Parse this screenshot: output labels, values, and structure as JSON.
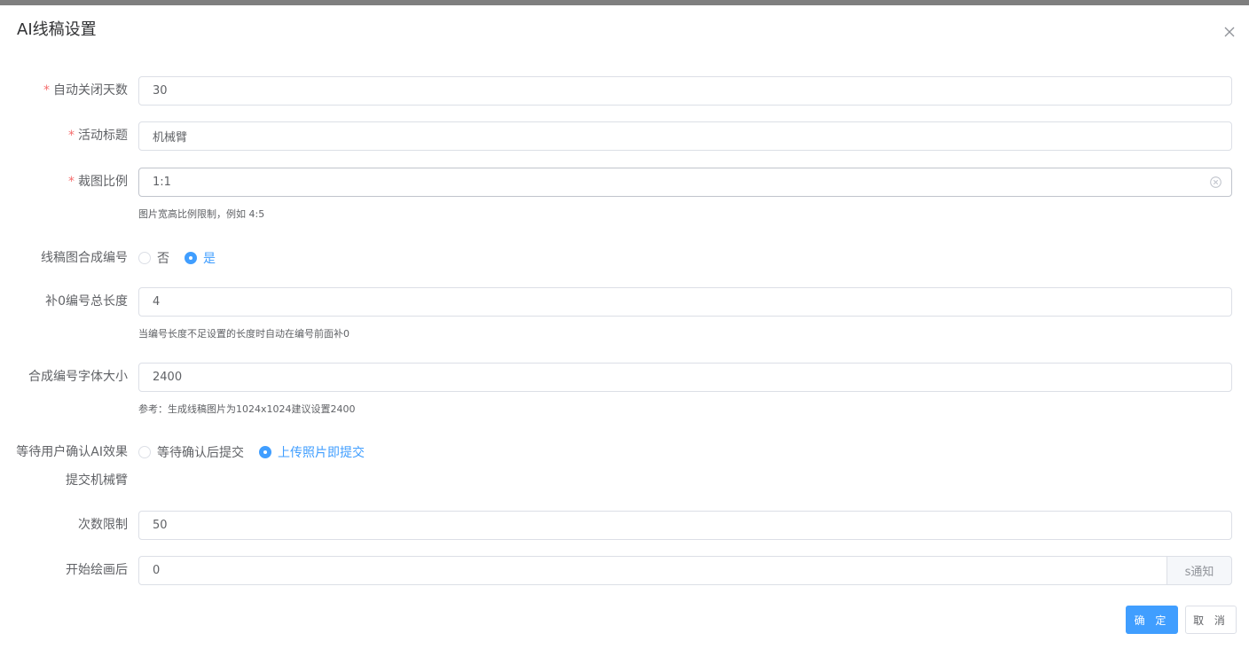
{
  "dialog": {
    "title": "AI线稿设置",
    "close_icon": "close-icon"
  },
  "form": {
    "auto_close_days": {
      "label": "自动关闭天数",
      "required": true,
      "value": "30"
    },
    "activity_title": {
      "label": "活动标题",
      "required": true,
      "value": "机械臂"
    },
    "crop_ratio": {
      "label": "裁图比例",
      "required": true,
      "value": "1:1",
      "tip": "图片宽高比例限制，例如 4:5",
      "clear_icon": "circle-close-icon"
    },
    "line_number_compose": {
      "label": "线稿图合成编号",
      "options": [
        "否",
        "是"
      ],
      "selected": "是"
    },
    "pad_zero_length": {
      "label": "补0编号总长度",
      "value": "4",
      "tip": "当编号长度不足设置的长度时自动在编号前面补0"
    },
    "number_font_size": {
      "label": "合成编号字体大小",
      "value": "2400",
      "tip": "参考：生成线稿图片为1024x1024建议设置2400"
    },
    "wait_confirm": {
      "label_line1": "等待用户确认AI效果",
      "label_line2": "提交机械臂",
      "options": [
        "等待确认后提交",
        "上传照片即提交"
      ],
      "selected": "上传照片即提交"
    },
    "count_limit": {
      "label": "次数限制",
      "value": "50"
    },
    "notify_after": {
      "label": "开始绘画后",
      "value": "0",
      "suffix": "s通知"
    }
  },
  "footer": {
    "confirm_label": "确 定",
    "cancel_label": "取 消"
  },
  "colors": {
    "primary": "#409eff",
    "required": "#f56c6c",
    "border": "#dcdfe6"
  }
}
